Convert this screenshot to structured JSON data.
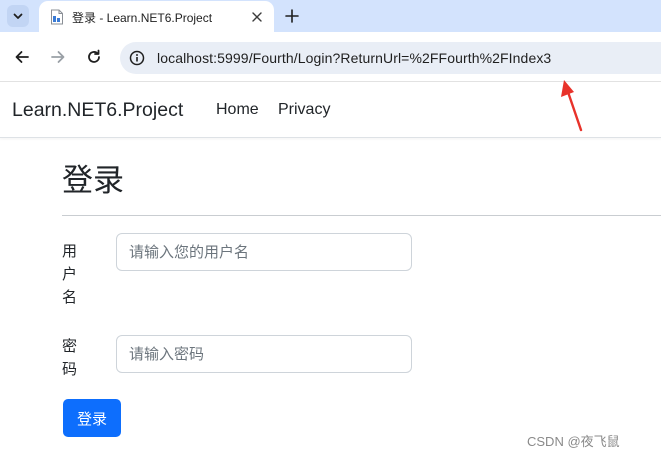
{
  "browser": {
    "tab": {
      "title": "登录 - Learn.NET6.Project"
    },
    "address_bar": {
      "url": "localhost:5999/Fourth/Login?ReturnUrl=%2FFourth%2FIndex3"
    }
  },
  "site": {
    "brand": "Learn.NET6.Project",
    "nav": [
      "Home",
      "Privacy"
    ]
  },
  "login": {
    "title": "登录",
    "username_label": "用户名",
    "username_placeholder": "请输入您的用户名",
    "password_label": "密码",
    "password_placeholder": "请输入密码",
    "submit_label": "登录"
  },
  "watermark": "CSDN @夜飞鼠",
  "colors": {
    "tabstrip": "#d3e3fd",
    "primary_button": "#0d6efd",
    "annotation_arrow": "#e8322a"
  }
}
